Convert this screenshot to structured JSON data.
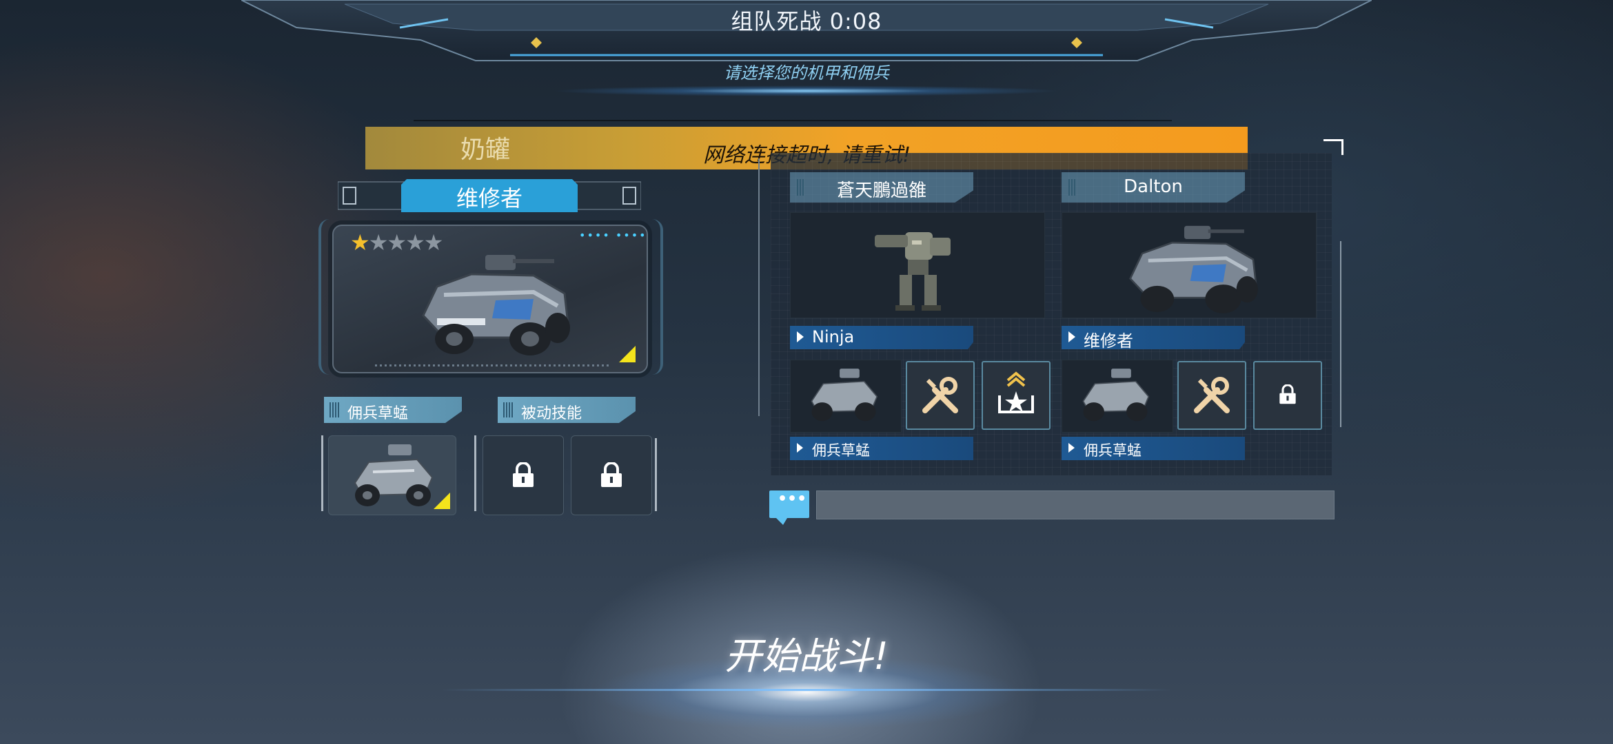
{
  "header": {
    "title": "组队死战 0:08",
    "subtitle": "请选择您的机甲和佣兵"
  },
  "notice": {
    "player_name": "奶罐",
    "message": "网络连接超时, 请重试!",
    "color": "#f2a226"
  },
  "left_panel": {
    "role_title": "维修者",
    "stars": {
      "filled": 1,
      "total": 5,
      "filled_glyph": "★",
      "empty_glyphs": "★★★★"
    },
    "card_dots": "•••• ••••",
    "mercenary_tab": "佣兵草蜢",
    "passive_tab": "被动技能",
    "passive_slots": [
      "lock-icon",
      "lock-icon"
    ]
  },
  "teammates": [
    {
      "name": "蒼天鵬過雒",
      "mech_label": "Ninja",
      "mercenary_label": "佣兵草蜢",
      "skills": [
        "wrench-screwdriver-icon",
        "rank-star-icon"
      ]
    },
    {
      "name": "Dalton",
      "mech_label": "维修者",
      "mercenary_label": "佣兵草蜢",
      "skills": [
        "wrench-screwdriver-icon",
        "lock-icon"
      ]
    }
  ],
  "chat": {
    "button_text": "•••",
    "input_value": ""
  },
  "start_button": {
    "label": "开始战斗!"
  },
  "colors": {
    "accent_blue": "#2aa0d8",
    "star": "#f5c02c",
    "label_blue": "#1f5a94",
    "notice_orange": "#f2a226"
  }
}
